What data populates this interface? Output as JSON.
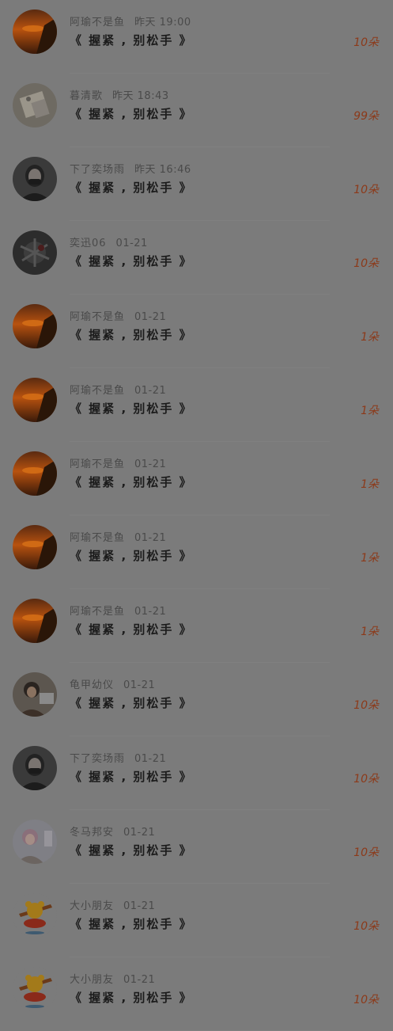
{
  "items": [
    {
      "name": "阿瑜不是鱼",
      "time": "昨天 19:00",
      "title": "《 握紧 , 别松手 》",
      "count": "10朵",
      "avatar": "sunset"
    },
    {
      "name": "暮清歌",
      "time": "昨天 18:43",
      "title": "《 握紧 , 别松手 》",
      "count": "99朵",
      "avatar": "book"
    },
    {
      "name": "下了奕场雨",
      "time": "昨天 16:46",
      "title": "《 握紧 , 别松手 》",
      "count": "10朵",
      "avatar": "girl-mask"
    },
    {
      "name": "奕迅06",
      "time": "01-21",
      "title": "《 握紧 , 别松手 》",
      "count": "10朵",
      "avatar": "dark-art"
    },
    {
      "name": "阿瑜不是鱼",
      "time": "01-21",
      "title": "《 握紧 , 别松手 》",
      "count": "1朵",
      "avatar": "sunset"
    },
    {
      "name": "阿瑜不是鱼",
      "time": "01-21",
      "title": "《 握紧 , 别松手 》",
      "count": "1朵",
      "avatar": "sunset"
    },
    {
      "name": "阿瑜不是鱼",
      "time": "01-21",
      "title": "《 握紧 , 别松手 》",
      "count": "1朵",
      "avatar": "sunset"
    },
    {
      "name": "阿瑜不是鱼",
      "time": "01-21",
      "title": "《 握紧 , 别松手 》",
      "count": "1朵",
      "avatar": "sunset"
    },
    {
      "name": "阿瑜不是鱼",
      "time": "01-21",
      "title": "《 握紧 , 别松手 》",
      "count": "1朵",
      "avatar": "sunset"
    },
    {
      "name": "龟甲幼仪",
      "time": "01-21",
      "title": "《 握紧 , 别松手 》",
      "count": "10朵",
      "avatar": "girl-laptop"
    },
    {
      "name": "下了奕场雨",
      "time": "01-21",
      "title": "《 握紧 , 别松手 》",
      "count": "10朵",
      "avatar": "girl-mask"
    },
    {
      "name": "冬马邦安",
      "time": "01-21",
      "title": "《 握紧 , 别松手 》",
      "count": "10朵",
      "avatar": "girl-light"
    },
    {
      "name": "大小朋友",
      "time": "01-21",
      "title": "《 握紧 , 别松手 》",
      "count": "10朵",
      "avatar": "pooh"
    },
    {
      "name": "大小朋友",
      "time": "01-21",
      "title": "《 握紧 , 别松手 》",
      "count": "10朵",
      "avatar": "pooh"
    }
  ]
}
